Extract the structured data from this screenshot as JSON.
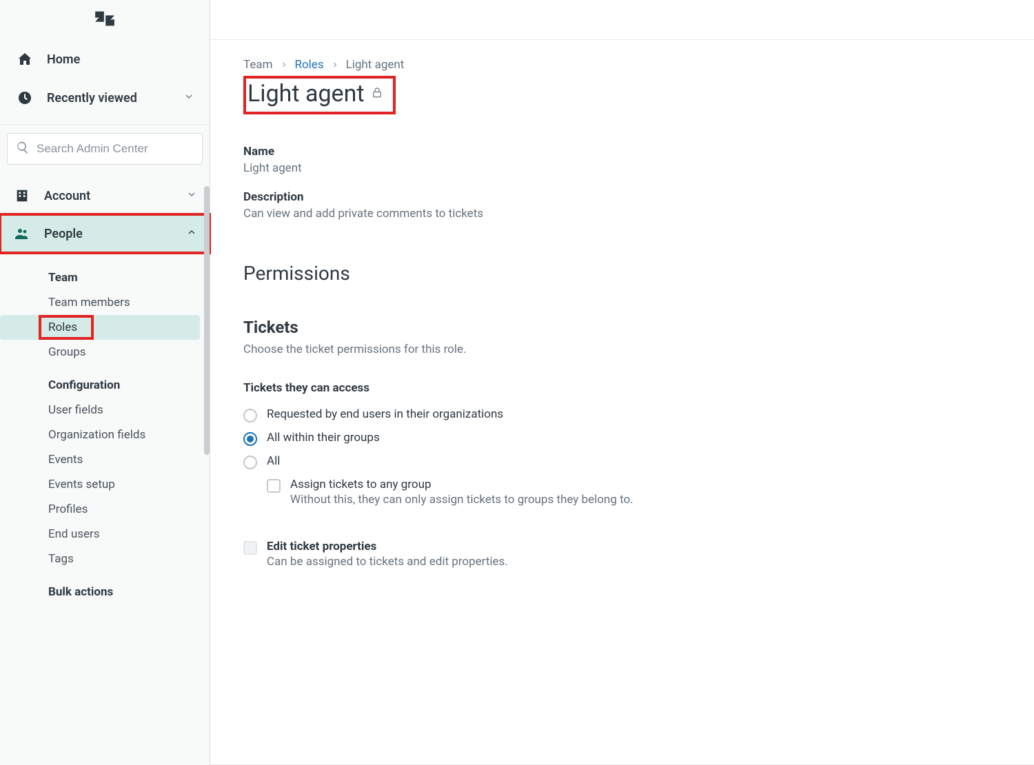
{
  "sidebar": {
    "home": "Home",
    "recently_viewed": "Recently viewed",
    "search_placeholder": "Search Admin Center",
    "sections": {
      "account": "Account",
      "people": "People"
    },
    "team_heading": "Team",
    "team_items": {
      "team_members": "Team members",
      "roles": "Roles",
      "groups": "Groups"
    },
    "configuration_heading": "Configuration",
    "configuration_items": {
      "user_fields": "User fields",
      "organization_fields": "Organization fields",
      "events": "Events",
      "events_setup": "Events setup",
      "profiles": "Profiles",
      "end_users": "End users",
      "tags": "Tags"
    },
    "bulk_actions_heading": "Bulk actions"
  },
  "breadcrumb": {
    "team": "Team",
    "roles": "Roles",
    "current": "Light agent"
  },
  "page": {
    "title": "Light agent",
    "name_label": "Name",
    "name_value": "Light agent",
    "description_label": "Description",
    "description_value": "Can view and add private comments to tickets",
    "permissions_heading": "Permissions",
    "tickets_heading": "Tickets",
    "tickets_desc": "Choose the ticket permissions for this role.",
    "access_label": "Tickets they can access",
    "access_options": {
      "org": "Requested by end users in their organizations",
      "groups": "All within their groups",
      "all": "All"
    },
    "assign_any_group": "Assign tickets to any group",
    "assign_any_group_desc": "Without this, they can only assign tickets to groups they belong to.",
    "edit_props": "Edit ticket properties",
    "edit_props_desc": "Can be assigned to tickets and edit properties."
  }
}
